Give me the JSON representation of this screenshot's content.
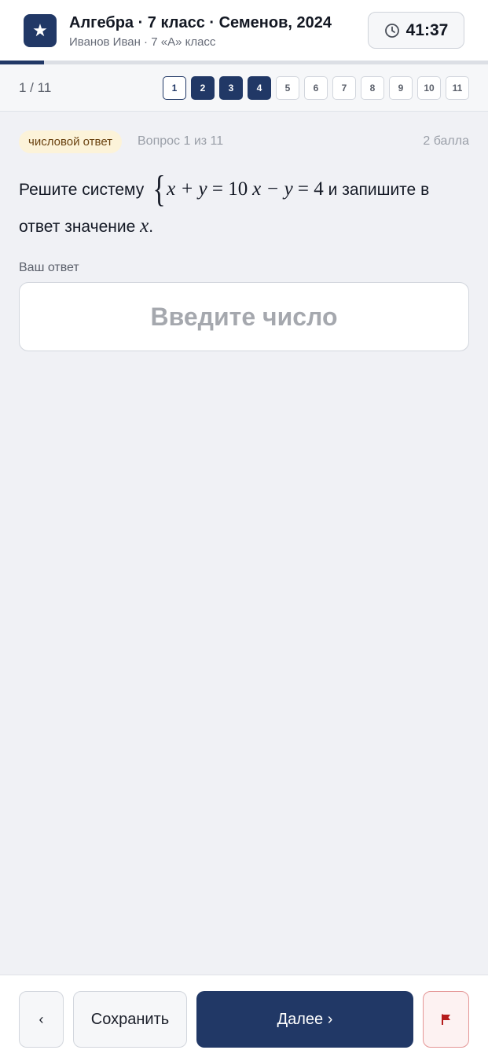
{
  "header": {
    "logo_icon": "★",
    "title": "Алгебра · 7 класс · Семенов, 2024",
    "subtitle": "Иванов Иван · 7 «А» класс",
    "timer": "41:37"
  },
  "progress": {
    "current": 1,
    "total": 11,
    "fraction": 0.09
  },
  "nav": {
    "counter": "1 / 11",
    "questions": [
      {
        "label": "1",
        "state": "current"
      },
      {
        "label": "2",
        "state": "answered"
      },
      {
        "label": "3",
        "state": "answered"
      },
      {
        "label": "4",
        "state": "answered"
      },
      {
        "label": "5",
        "state": "unanswered"
      },
      {
        "label": "6",
        "state": "unanswered"
      },
      {
        "label": "7",
        "state": "unanswered"
      },
      {
        "label": "8",
        "state": "unanswered"
      },
      {
        "label": "9",
        "state": "unanswered"
      },
      {
        "label": "10",
        "state": "unanswered"
      },
      {
        "label": "11",
        "state": "unanswered"
      }
    ]
  },
  "question": {
    "badge": "числовой ответ",
    "label": "Вопрос 1 из 11",
    "points": "2 балла",
    "text_before": "Решите систему",
    "equation_1": {
      "lhs": "x + y",
      "eq": "=",
      "rhs": "10"
    },
    "equation_2": {
      "lhs": "x − y",
      "eq": "=",
      "rhs": "4"
    },
    "text_after": "и запишите в ответ значение",
    "variable": "x",
    "end": "."
  },
  "answer": {
    "label": "Ваш ответ",
    "placeholder": "Введите число",
    "value": ""
  },
  "footer": {
    "prev_label": "‹",
    "save_label": "Сохранить",
    "next_label": "Далее ›"
  },
  "colors": {
    "primary": "#213866",
    "badge_bg": "#fcf3d9",
    "badge_text": "#6a4210",
    "flag": "#b51c1c"
  },
  "icons": {
    "timer": "clock-icon",
    "flag": "flag-icon"
  }
}
